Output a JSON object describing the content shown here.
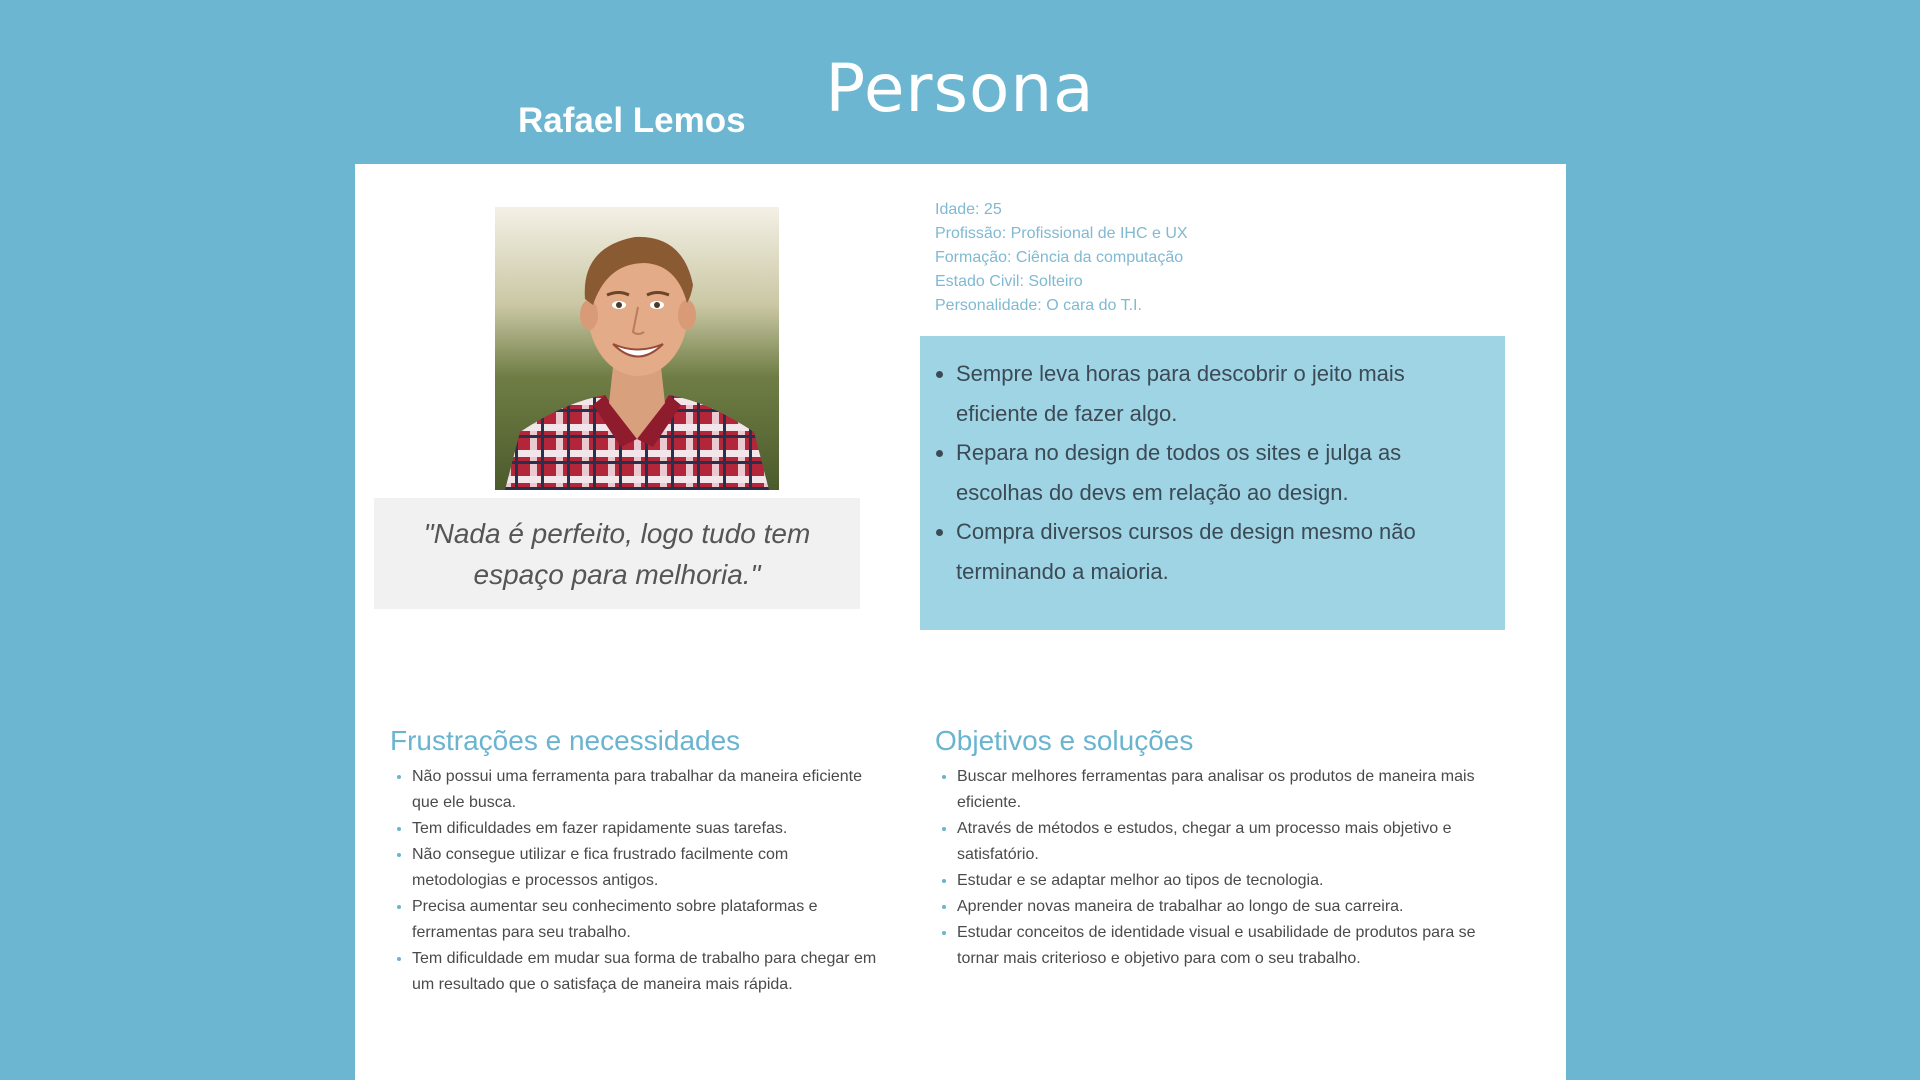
{
  "header": {
    "title": "Persona",
    "name": "Rafael Lemos"
  },
  "profile": {
    "photo_icon": "person-photo",
    "quote": "\"Nada é perfeito, logo tudo tem espaço para melhoria.\"",
    "info": [
      "Idade: 25",
      "Profissão: Profissional de IHC e UX",
      "Formação: Ciência da computação",
      "Estado Civil: Solteiro",
      "Personalidade: O cara do T.I."
    ],
    "traits": [
      "Sempre leva horas para descobrir o jeito mais eficiente de fazer algo.",
      "Repara no design de todos os sites e julga as escolhas do devs em relação ao design.",
      "Compra diversos cursos de design mesmo não terminando a maioria."
    ]
  },
  "frustrations": {
    "title": "Frustrações e necessidades",
    "items": [
      "Não possui uma ferramenta para trabalhar da maneira eficiente que ele busca.",
      "Tem dificuldades em fazer rapidamente suas tarefas.",
      "Não consegue utilizar e fica frustrado facilmente com metodologias e processos antigos.",
      "Precisa aumentar seu conhecimento sobre plataformas e ferramentas para  seu trabalho.",
      "Tem dificuldade em mudar sua forma de trabalho para chegar em um resultado que o satisfaça de maneira mais rápida."
    ]
  },
  "goals": {
    "title": "Objetivos e soluções",
    "items": [
      "Buscar melhores ferramentas para analisar os produtos de maneira mais eficiente.",
      "Através de métodos e estudos, chegar a um processo mais objetivo e satisfatório.",
      "Estudar e se adaptar melhor ao tipos de tecnologia.",
      "Aprender novas maneira de trabalhar ao longo de sua carreira.",
      "Estudar conceitos de identidade visual e usabilidade de produtos para se tornar mais criterioso e objetivo para com o seu trabalho."
    ]
  },
  "colors": {
    "background": "#6cb6d1",
    "accent": "#6ab4d0",
    "traits_box": "#9ed4e4",
    "quote_box": "#f1f1f1"
  }
}
